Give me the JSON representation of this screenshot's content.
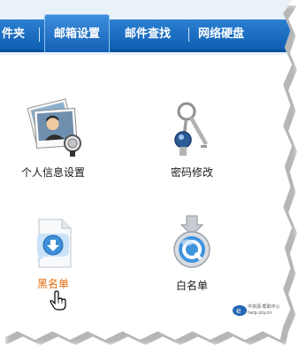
{
  "tabs": [
    {
      "label": "件夹"
    },
    {
      "label": "邮箱设置"
    },
    {
      "label": "邮件查找"
    },
    {
      "label": "网络硬盘"
    }
  ],
  "items": [
    {
      "label": "个人信息设置",
      "icon": "profile-photos-icon"
    },
    {
      "label": "密码修改",
      "icon": "keys-icon"
    },
    {
      "label": "黑名单",
      "icon": "download-document-icon"
    },
    {
      "label": "白名单",
      "icon": "quicktime-icon"
    }
  ],
  "logo": {
    "line1": "中资源·帮助中心",
    "line2": "help.zzy.cn"
  },
  "colors": {
    "tab_bar": "#1a6cc2",
    "active_label": "#e06a0e"
  }
}
